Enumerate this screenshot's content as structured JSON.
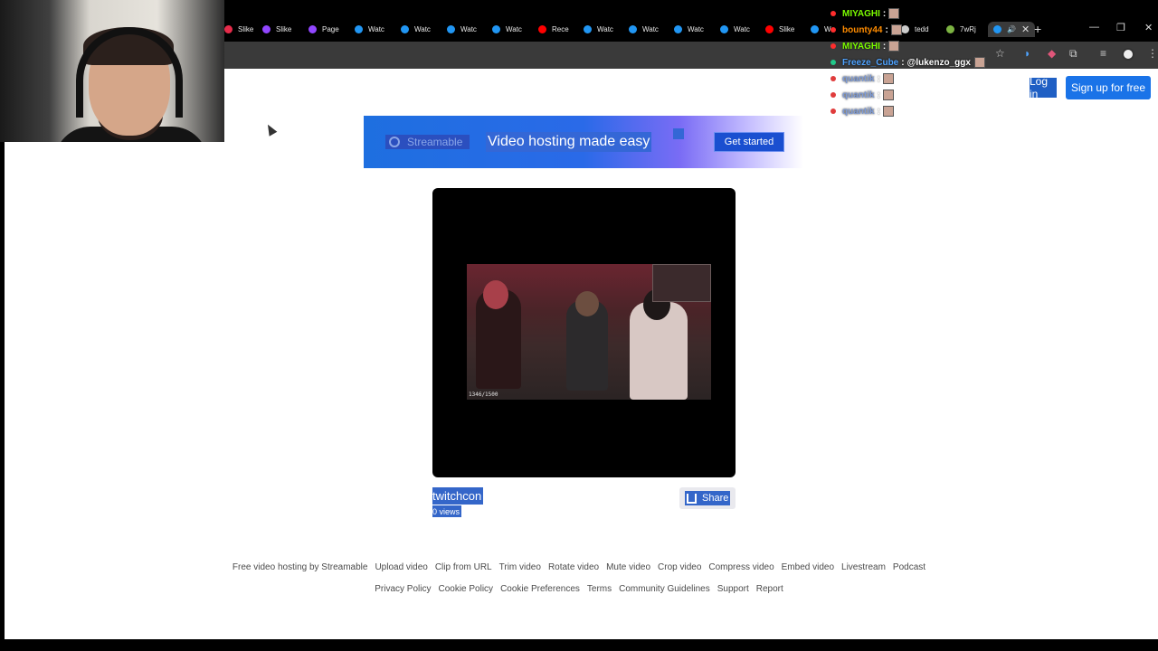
{
  "browser": {
    "tabs": [
      {
        "label": "Slike",
        "color": "#e62b4a"
      },
      {
        "label": "Slike",
        "color": "#9146ff"
      },
      {
        "label": "Page",
        "color": "#9146ff"
      },
      {
        "label": "Watc",
        "color": "#2196f3"
      },
      {
        "label": "Watc",
        "color": "#2196f3"
      },
      {
        "label": "Watc",
        "color": "#2196f3"
      },
      {
        "label": "Watc",
        "color": "#2196f3"
      },
      {
        "label": "Rece",
        "color": "#ff0000"
      },
      {
        "label": "Watc",
        "color": "#2196f3"
      },
      {
        "label": "Watc",
        "color": "#2196f3"
      },
      {
        "label": "Watc",
        "color": "#2196f3"
      },
      {
        "label": "Watc",
        "color": "#2196f3"
      },
      {
        "label": "Slike",
        "color": "#ff0000"
      },
      {
        "label": "W",
        "color": "#2196f3"
      },
      {
        "label": "tedd",
        "color": "#cccccc"
      },
      {
        "label": "7wRj",
        "color": "#7cb342"
      }
    ],
    "new_tab_icon": "plus-icon",
    "window_controls": [
      "minimize-icon",
      "restore-icon",
      "close-icon"
    ]
  },
  "header": {
    "login_label": "Log in",
    "signup_label": "Sign up for free"
  },
  "banner": {
    "logo_text": "Streamable",
    "headline": "Video hosting made easy",
    "cta_label": "Get started"
  },
  "video": {
    "frame_counter": "1346/1500",
    "title": "twitchcon",
    "views": "0 views",
    "share_label": "Share"
  },
  "footer": {
    "row1": [
      "Free video hosting by Streamable",
      "Upload video",
      "Clip from URL",
      "Trim video",
      "Rotate video",
      "Mute video",
      "Crop video",
      "Compress video",
      "Embed video",
      "Livestream",
      "Podcast"
    ],
    "row2": [
      "Privacy Policy",
      "Cookie Policy",
      "Cookie Preferences",
      "Terms",
      "Community Guidelines",
      "Support",
      "Report"
    ]
  },
  "chat": [
    {
      "user": "MIYAGHI",
      "color": "#7cfc00",
      "message": "",
      "dot": "#ff2d2d"
    },
    {
      "user": "bounty44",
      "color": "#ff8c00",
      "message": "",
      "dot": "#ff2d2d"
    },
    {
      "user": "MIYAGHI",
      "color": "#7cfc00",
      "message": "",
      "dot": "#ff2d2d"
    },
    {
      "user": "Freeze_Cube",
      "color": "#4fa3ff",
      "message": "@lukenzo_ggx",
      "dot": "#21c98a"
    },
    {
      "user": "quantik",
      "color": "#7e9bd6",
      "message": "",
      "dot": "#e03c3c"
    },
    {
      "user": "quantik",
      "color": "#7e9bd6",
      "message": "",
      "dot": "#e03c3c"
    },
    {
      "user": "quantik",
      "color": "#7e9bd6",
      "message": "",
      "dot": "#e03c3c"
    }
  ]
}
